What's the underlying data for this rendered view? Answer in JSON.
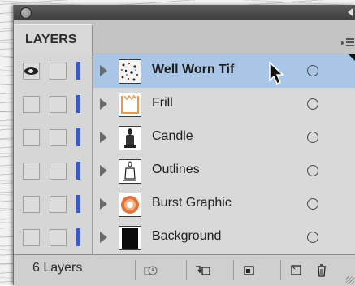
{
  "panel": {
    "tab_label": "LAYERS",
    "layer_count_label": "6 Layers"
  },
  "layers": [
    {
      "name": "Well Worn Tif",
      "selected": true,
      "visible": true,
      "thumb": "texture-thumbnail"
    },
    {
      "name": "Frill",
      "selected": false,
      "visible": false,
      "thumb": "frill-thumbnail"
    },
    {
      "name": "Candle",
      "selected": false,
      "visible": false,
      "thumb": "candle-thumbnail"
    },
    {
      "name": "Outlines",
      "selected": false,
      "visible": false,
      "thumb": "outline-thumbnail"
    },
    {
      "name": "Burst Graphic",
      "selected": false,
      "visible": false,
      "thumb": "burst-thumbnail"
    },
    {
      "name": "Background",
      "selected": false,
      "visible": false,
      "thumb": "black-fill-thumbnail"
    }
  ],
  "footer_buttons": [
    "locate-object-icon",
    "make-clipping-mask-icon",
    "create-new-sublayer-icon",
    "create-new-layer-icon",
    "delete-selection-icon"
  ],
  "colors": {
    "layer_color": "#3a58c9",
    "selection": "#a9c6e6",
    "panel_bg": "#d6d6d6"
  }
}
